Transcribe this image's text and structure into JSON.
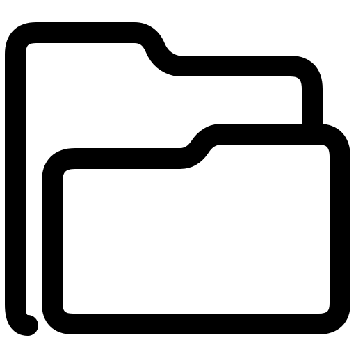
{
  "icon": {
    "name": "folder-open-icon",
    "stroke_color": "#000000",
    "background_color": "#ffffff"
  }
}
